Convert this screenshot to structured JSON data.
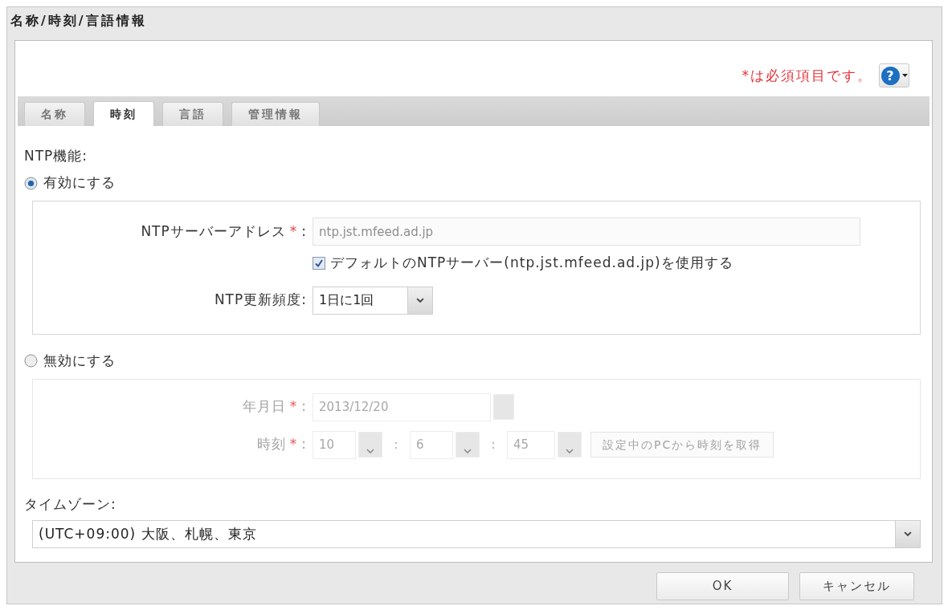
{
  "window": {
    "title": "名称/時刻/言語情報"
  },
  "required_note": "*は必須項目です。",
  "help_button": {
    "glyph": "?"
  },
  "tabs": [
    {
      "label": "名称",
      "selected": false
    },
    {
      "label": "時刻",
      "selected": true
    },
    {
      "label": "言語",
      "selected": false
    },
    {
      "label": "管理情報",
      "selected": false
    }
  ],
  "ntp_function": {
    "label": "NTP機能:",
    "modes": [
      {
        "label": "有効にする",
        "selected": true,
        "fields": [
          {
            "kind": "text",
            "label": "NTPサーバーアドレス",
            "required_mark": "*",
            "separator": ":",
            "value": "ntp.jst.mfeed.ad.jp",
            "disabled": true
          },
          {
            "kind": "checkbox",
            "label": "デフォルトのNTPサーバー(ntp.jst.mfeed.ad.jp)を使用する",
            "checked": true
          },
          {
            "kind": "select",
            "label": "NTP更新頻度:",
            "value": "1日に1回"
          }
        ]
      },
      {
        "label": "無効にする",
        "selected": false,
        "fields": [
          {
            "kind": "date",
            "label": "年月日",
            "required_mark": "*",
            "separator": ":",
            "value": "2013/12/20"
          },
          {
            "kind": "time",
            "label": "時刻",
            "required_mark": "*",
            "separator": ":",
            "parts": [
              "10",
              "6",
              "45"
            ],
            "part_separators": [
              ":",
              ":"
            ],
            "button": "設定中のPCから時刻を取得"
          }
        ]
      }
    ]
  },
  "timezone": {
    "label": "タイムゾーン:",
    "value": "(UTC+09:00) 大阪、札幌、東京"
  },
  "buttons": [
    "OK",
    "キャンセル"
  ]
}
